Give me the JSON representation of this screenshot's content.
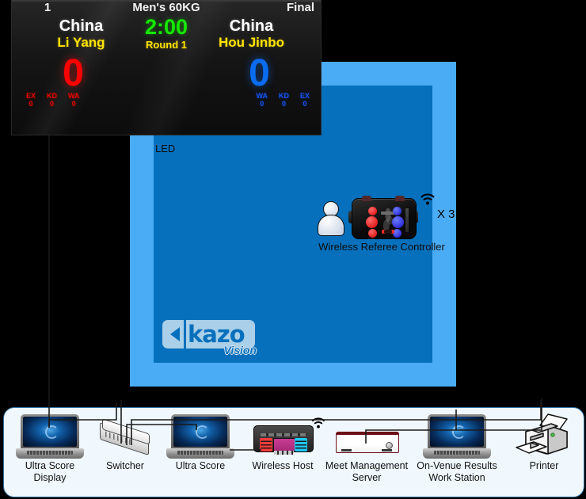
{
  "scoreboard": {
    "mat_number": "1",
    "event": "Men's 60KG",
    "phase": "Final",
    "clock": "2:00",
    "round": "Round 1",
    "red": {
      "noc": "China",
      "athlete": "Li Yang",
      "score": "0",
      "penalties": [
        {
          "key": "EX",
          "value": "0"
        },
        {
          "key": "KD",
          "value": "0"
        },
        {
          "key": "WA",
          "value": "0"
        }
      ],
      "color": "#ff0000"
    },
    "blue": {
      "noc": "China",
      "athlete": "Hou Jinbo",
      "score": "0",
      "penalties": [
        {
          "key": "WA",
          "value": "0"
        },
        {
          "key": "KD",
          "value": "0"
        },
        {
          "key": "EX",
          "value": "0"
        }
      ],
      "color": "#0a6cf0"
    },
    "clock_color": "#15e800",
    "name_color": "#ffe400"
  },
  "mat": {
    "led_label": "LED",
    "outer_color": "#4aacf5",
    "inner_color": "#0670bd",
    "logo": {
      "word": "kazo",
      "subtitle": "Vision"
    },
    "referee": {
      "caption": "Wireless Referee Controller",
      "multiplier": "X 3",
      "person_icon": "person-icon",
      "wifi_icon": "wifi-icon"
    }
  },
  "panel": {
    "devices": [
      {
        "id": "ultra-score-display",
        "label": "Ultra Score\nDisplay",
        "label_lines": [
          "Ultra Score",
          "Display"
        ],
        "icon": "laptop-icon"
      },
      {
        "id": "switcher",
        "label": "Switcher",
        "label_lines": [
          "Switcher"
        ],
        "icon": "switcher-icon"
      },
      {
        "id": "ultra-score",
        "label": "Ultra Score",
        "label_lines": [
          "Ultra Score"
        ],
        "icon": "laptop-icon"
      },
      {
        "id": "wireless-host",
        "label": "Wireless Host",
        "label_lines": [
          "Wireless Host"
        ],
        "icon": "wireless-host-icon"
      },
      {
        "id": "meet-management-server",
        "label": "Meet Management\nServer",
        "label_lines": [
          "Meet Management",
          "Server"
        ],
        "icon": "server-icon"
      },
      {
        "id": "on-venue-results-work-station",
        "label": "On-Venue Results\nWork Station",
        "label_lines": [
          "On-Venue Results",
          "Work Station"
        ],
        "icon": "laptop-icon"
      },
      {
        "id": "printer",
        "label": "Printer",
        "label_lines": [
          "Printer"
        ],
        "icon": "printer-icon"
      }
    ],
    "background": "#f0f8fe",
    "border": "#2e6fa3"
  },
  "page": {
    "background": "#000000"
  }
}
